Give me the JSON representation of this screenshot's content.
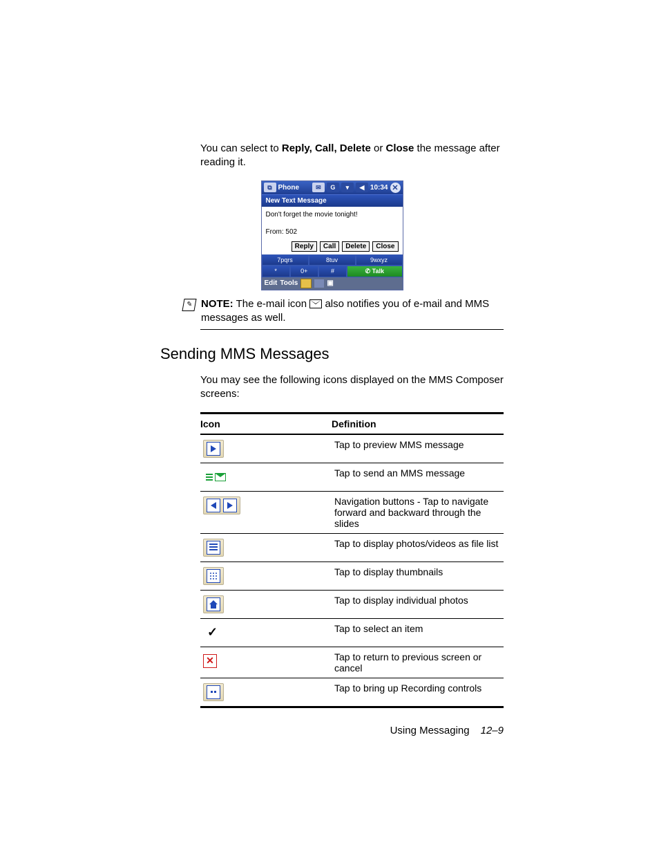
{
  "intro": {
    "pre": "You can select to ",
    "bold": "Reply, Call, Delete",
    "mid": " or ",
    "bold2": "Close",
    "post": " the message after reading it."
  },
  "shot": {
    "app": "Phone",
    "time": "10:34",
    "tab": "New Text Message",
    "body": "Don't forget the movie tonight!",
    "from": "From: 502",
    "buttons": {
      "reply": "Reply",
      "call": "Call",
      "delete": "Delete",
      "close": "Close"
    },
    "keys": {
      "k7": "7pqrs",
      "k8": "8tuv",
      "k9": "9wxyz",
      "star": "*",
      "k0": "0+",
      "hash": "#",
      "talk": "Talk"
    },
    "bottombar": {
      "edit": "Edit",
      "tools": "Tools"
    }
  },
  "note": {
    "label": "NOTE:",
    "pre": "The e-mail icon ",
    "post": " also notifies you of e-mail and MMS messages as well."
  },
  "section_heading": "Sending MMS Messages",
  "section_intro": "You may see the following icons displayed on the MMS Composer screens:",
  "table": {
    "head": {
      "icon": "Icon",
      "def": "Definition"
    },
    "rows": [
      {
        "def": "Tap to preview MMS message"
      },
      {
        "def": "Tap to send an MMS message"
      },
      {
        "def": "Navigation buttons - Tap to navigate forward and backward through the slides"
      },
      {
        "def": "Tap to display photos/videos as file list"
      },
      {
        "def": "Tap to display thumbnails"
      },
      {
        "def": "Tap to display individual photos"
      },
      {
        "def": "Tap to select an item"
      },
      {
        "def": "Tap to return to previous screen or cancel"
      },
      {
        "def": "Tap to bring up Recording controls"
      }
    ]
  },
  "footer": {
    "label": "Using Messaging",
    "page": "12–9"
  }
}
